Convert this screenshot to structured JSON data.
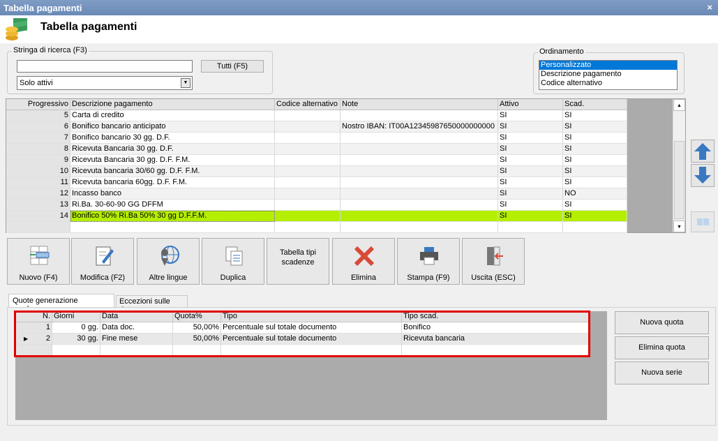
{
  "window": {
    "title": "Tabella pagamenti",
    "close": "×"
  },
  "header": {
    "title": "Tabella pagamenti",
    "icon": "coins-money-icon"
  },
  "search": {
    "label": "Stringa di ricerca (F3)",
    "value": "",
    "all_button": "Tutti (F5)",
    "filter": "Solo attivi"
  },
  "ordering": {
    "label": "Ordinamento",
    "options": [
      "Personalizzato",
      "Descrizione pagamento",
      "Codice alternativo"
    ],
    "selected": "Personalizzato"
  },
  "grid": {
    "columns": [
      "Progressivo",
      "Descrizione pagamento",
      "Codice alternativo",
      "Note",
      "Attivo",
      "Scad."
    ],
    "rows": [
      [
        "5",
        "Carta di credito",
        "",
        "",
        "SI",
        "SI"
      ],
      [
        "6",
        "Bonifico bancario anticipato",
        "",
        "Nostro IBAN: IT00A12345987650000000000",
        "SI",
        "SI"
      ],
      [
        "7",
        "Bonifico bancario 30 gg. D.F.",
        "",
        "",
        "SI",
        "SI"
      ],
      [
        "8",
        "Ricevuta Bancaria 30 gg. D.F.",
        "",
        "",
        "SI",
        "SI"
      ],
      [
        "9",
        "Ricevuta Bancaria 30 gg. D.F. F.M.",
        "",
        "",
        "SI",
        "SI"
      ],
      [
        "10",
        "Ricevuta bancaria 30/60 gg. D.F. F.M.",
        "",
        "",
        "SI",
        "SI"
      ],
      [
        "11",
        "Ricevuta bancaria 60gg. D.F. F.M.",
        "",
        "",
        "SI",
        "SI"
      ],
      [
        "12",
        "Incasso banco",
        "",
        "",
        "SI",
        "NO"
      ],
      [
        "13",
        "Ri.Ba. 30-60-90 GG DFFM",
        "",
        "",
        "SI",
        "SI"
      ],
      [
        "14",
        "Bonifico 50% Ri.Ba 50% 30 gg D.F.F.M.",
        "",
        "",
        "SI",
        "SI"
      ]
    ],
    "selected_row": 9,
    "highlight": "#b4ee00"
  },
  "toolbar": [
    "Nuovo (F4)",
    "Modifica (F2)",
    "Altre lingue",
    "Duplica",
    "Tabella tipi scadenze",
    "Elimina",
    "Stampa (F9)",
    "Uscita (ESC)"
  ],
  "tabs": [
    "Quote generazione scadenze",
    "Eccezioni sulle date"
  ],
  "detail": {
    "columns": [
      "N.",
      "Giorni",
      "Data",
      "Quota%",
      "Tipo",
      "Tipo scad."
    ],
    "rows": [
      [
        "1",
        "0 gg.",
        "Data doc.",
        "50,00%",
        "Percentuale sul totale documento",
        "Bonifico"
      ],
      [
        "2",
        "30 gg.",
        "Fine mese",
        "50,00%",
        "Percentuale sul totale documento",
        "Ricevuta bancaria"
      ]
    ],
    "current_row": 1
  },
  "side_buttons": [
    "Nuova quota",
    "Elimina quota",
    "Nuova serie"
  ]
}
